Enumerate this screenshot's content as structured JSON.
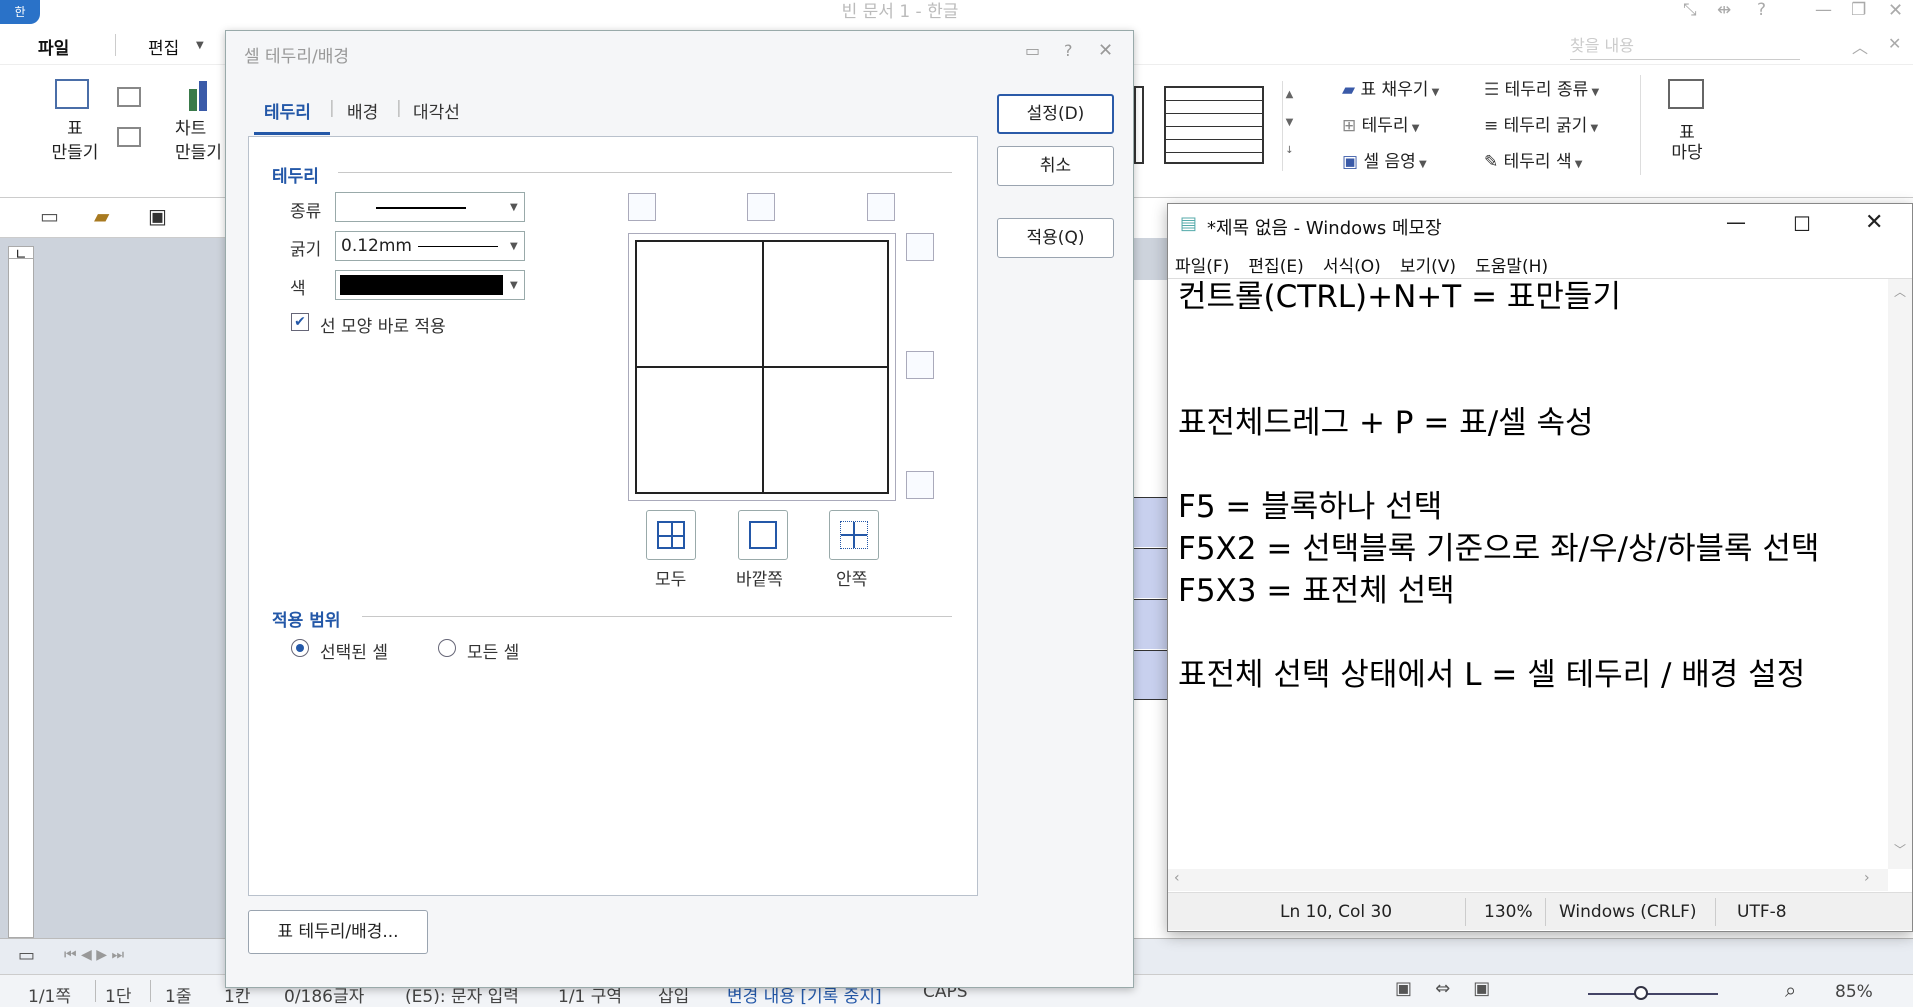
{
  "app": {
    "logo": "한",
    "title": "빈 문서 1 - 한글",
    "search_placeholder": "찾을 내용"
  },
  "menu": {
    "file": "파일",
    "edit": "편집"
  },
  "ribbon": {
    "table_make": "표\n만들기",
    "chart_make": "차트\n만들기",
    "table_fill": "표 채우기",
    "border": "테두리",
    "cell_shade": "셀 음영",
    "border_type": "테두리 종류",
    "border_thick": "테두리 굵기",
    "border_color": "테두리 색",
    "table_madang_1": "표",
    "table_madang_2": "마당"
  },
  "dialog": {
    "title": "셀 테두리/배경",
    "tabs": [
      "테두리",
      "배경",
      "대각선"
    ],
    "section_border": "테두리",
    "type_label": "종류",
    "thickness_label": "굵기",
    "thickness_value": "0.12mm",
    "color_label": "색",
    "line_color": "#000000",
    "apply_immediately": "선 모양 바로 적용",
    "apply_immediately_checked": true,
    "preset_all": "모두",
    "preset_outside": "바깥쪽",
    "preset_inside": "안쪽",
    "section_scope": "적용 범위",
    "scope_selected": "선택된 셀",
    "scope_all": "모든 셀",
    "scope_value": "선택된 셀",
    "btn_set": "설정(D)",
    "btn_cancel": "취소",
    "btn_apply": "적용(Q)",
    "btn_table_border": "표 테두리/배경..."
  },
  "notepad": {
    "title": "*제목 없음 - Windows 메모장",
    "menu": [
      "파일(F)",
      "편집(E)",
      "서식(O)",
      "보기(V)",
      "도움말(H)"
    ],
    "lines": [
      "컨트롤(CTRL)+N+T = 표만들기",
      "",
      "",
      "표전체드레그 + P = 표/셀 속성",
      "",
      "F5 = 블록하나 선택",
      "F5X2 = 선택블록 기준으로 좌/우/상/하블록 선택",
      "F5X3 = 표전체 선택",
      "",
      "표전체 선택 상태에서 L = 셀 테두리 / 배경 설정"
    ],
    "status": {
      "position": "Ln 10, Col 30",
      "zoom": "130%",
      "eol": "Windows (CRLF)",
      "encoding": "UTF-8"
    }
  },
  "statusbar": {
    "page": "1/1쪽",
    "column": "1단",
    "line": "1줄",
    "col": "1칸",
    "chars": "0/186글자",
    "mode": "(E5): 문자 입력",
    "section": "1/1 구역",
    "insert": "삽입",
    "track": "변경 내용 [기록 중지]",
    "caps": "CAPS",
    "zoom": "85%"
  },
  "colors": {
    "accent": "#2458a8",
    "selected_cell": "#c8d0ee"
  }
}
